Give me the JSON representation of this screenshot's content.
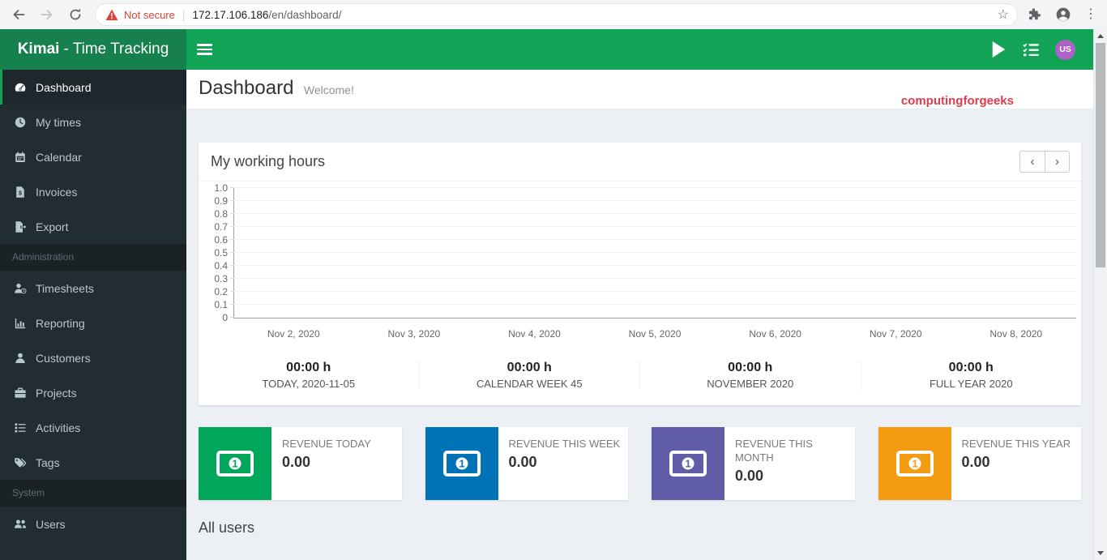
{
  "theme": {
    "header-green": "#12a357",
    "logo-green": "#16814f",
    "accent": "#12a357",
    "sidebar-bg": "#222d32",
    "sidebar-active-bg": "#1e282c",
    "content-bg": "#ecf0f5",
    "watermark-red": "#e23b4c",
    "warning-red": "#dd4434",
    "avatar-purple": "#ad63c6"
  },
  "browser": {
    "security_label": "Not secure",
    "url_host": "172.17.106.186",
    "url_path": "/en/dashboard/"
  },
  "app_header": {
    "logo_bold": "Kimai",
    "logo_rest": "- Time Tracking",
    "avatar_initials": "US"
  },
  "sidebar": {
    "items": [
      {
        "label": "Dashboard"
      },
      {
        "label": "My times"
      },
      {
        "label": "Calendar"
      },
      {
        "label": "Invoices"
      },
      {
        "label": "Export"
      },
      {
        "label": "Administration"
      },
      {
        "label": "Timesheets"
      },
      {
        "label": "Reporting"
      },
      {
        "label": "Customers"
      },
      {
        "label": "Projects"
      },
      {
        "label": "Activities"
      },
      {
        "label": "Tags"
      },
      {
        "label": "System"
      },
      {
        "label": "Users"
      }
    ]
  },
  "page": {
    "title": "Dashboard",
    "subtitle": "Welcome!",
    "watermark": "computingforgeeks",
    "all_users_title": "All users"
  },
  "working_hours": {
    "title": "My working hours",
    "prev_button": "‹",
    "next_button": "›"
  },
  "stats": [
    {
      "value": "00:00 h",
      "label": "TODAY, 2020-11-05"
    },
    {
      "value": "00:00 h",
      "label": "CALENDAR WEEK 45"
    },
    {
      "value": "00:00 h",
      "label": "NOVEMBER 2020"
    },
    {
      "value": "00:00 h",
      "label": "FULL YEAR 2020"
    }
  ],
  "revenue_boxes": [
    {
      "label": "REVENUE TODAY",
      "value": "0.00",
      "color": "#00a65a"
    },
    {
      "label": "REVENUE THIS WEEK",
      "value": "0.00",
      "color": "#0073b7"
    },
    {
      "label": "REVENUE THIS MONTH",
      "value": "0.00",
      "color": "#605ca8"
    },
    {
      "label": "REVENUE THIS YEAR",
      "value": "0.00",
      "color": "#f39c12"
    }
  ],
  "chart_data": {
    "type": "bar",
    "title": "My working hours",
    "x": [
      "Nov 2, 2020",
      "Nov 3, 2020",
      "Nov 4, 2020",
      "Nov 5, 2020",
      "Nov 6, 2020",
      "Nov 7, 2020",
      "Nov 8, 2020"
    ],
    "series": [
      {
        "name": "My working hours",
        "values": [
          0,
          0,
          0,
          0,
          0,
          0,
          0
        ]
      }
    ],
    "ylim": [
      0,
      1.0
    ],
    "yticks": [
      0,
      0.1,
      0.2,
      0.3,
      0.4,
      0.5,
      0.6,
      0.7,
      0.8,
      0.9,
      1.0
    ],
    "grid": true,
    "legend": false
  }
}
